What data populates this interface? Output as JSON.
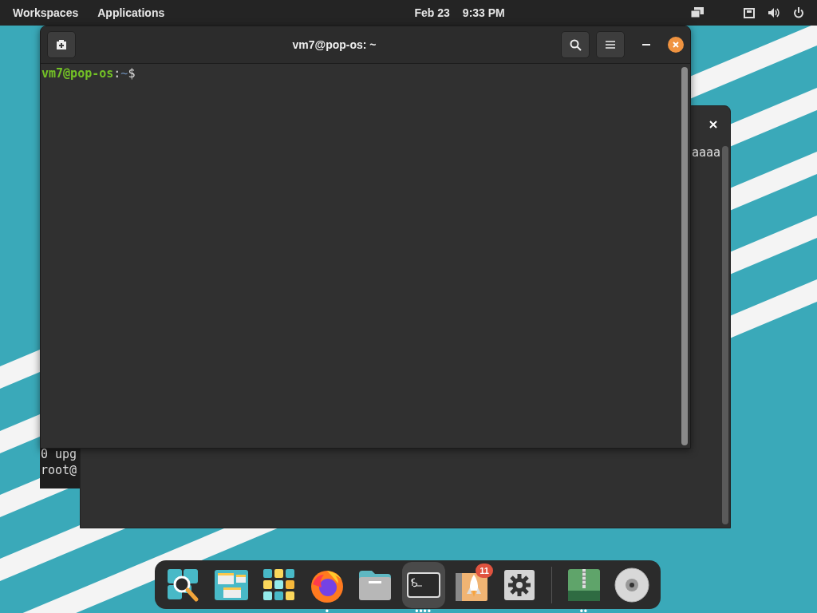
{
  "top_bar": {
    "menus": [
      {
        "label": "Workspaces"
      },
      {
        "label": "Applications"
      }
    ],
    "date": "Feb 23",
    "time": "9:33 PM"
  },
  "back_window_left": {
    "lines": [
      "0 upg",
      "root@"
    ]
  },
  "back_window": {
    "lines": [
      "aaaa"
    ]
  },
  "terminal": {
    "title": "vm7@pop-os: ~",
    "prompt": {
      "user_host": "vm7@pop-os",
      "colon": ":",
      "path": "~",
      "symbol": "$"
    }
  },
  "dock": {
    "items": [
      {
        "kind": "search",
        "selected": false
      },
      {
        "kind": "workspaces",
        "selected": false
      },
      {
        "kind": "apps",
        "selected": false
      },
      {
        "kind": "browser",
        "selected": false,
        "window_dots": "•"
      },
      {
        "kind": "files",
        "selected": false
      },
      {
        "kind": "terminal",
        "selected": true,
        "window_dots": "••••"
      },
      {
        "kind": "store",
        "selected": false,
        "badge": "11"
      },
      {
        "kind": "settings",
        "selected": false
      },
      {
        "kind": "separator"
      },
      {
        "kind": "archive",
        "selected": false,
        "window_dots": "••"
      },
      {
        "kind": "disc",
        "selected": false
      }
    ]
  }
}
